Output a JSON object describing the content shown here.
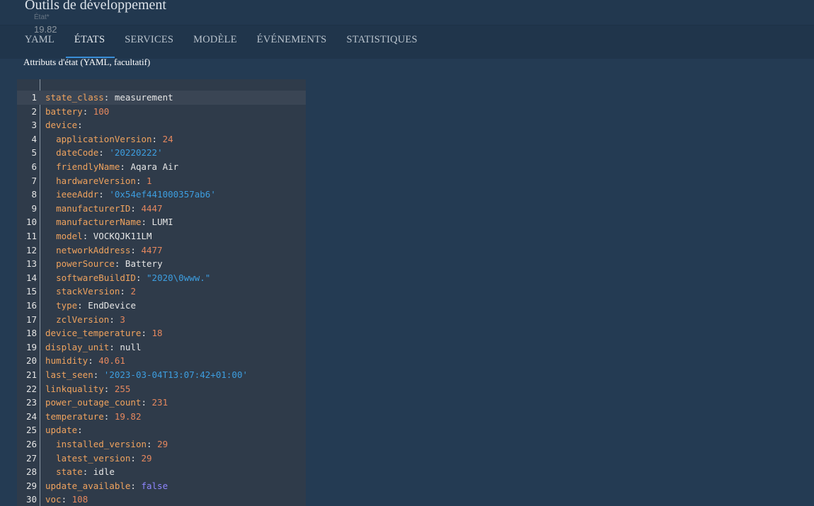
{
  "header": {
    "title": "Outils de développement"
  },
  "state_field": {
    "label": "État*",
    "value": "19.82"
  },
  "tabs": [
    {
      "label": "YAML",
      "active": false
    },
    {
      "label": "ÉTATS",
      "active": true
    },
    {
      "label": "SERVICES",
      "active": false
    },
    {
      "label": "MODÈLE",
      "active": false
    },
    {
      "label": "ÉVÉNEMENTS",
      "active": false
    },
    {
      "label": "STATISTIQUES",
      "active": false
    }
  ],
  "attributes_label": "Attributs d'état (YAML, facultatif)",
  "colors": {
    "background": "#243b53",
    "editor_bg": "#2f3b4a",
    "key": "#f0a35e",
    "number": "#e6885e",
    "string": "#3d9ee0",
    "boolean": "#8f86ff",
    "tab_indicator": "#3a8fd8"
  },
  "editor": {
    "lines": [
      {
        "num": "1",
        "indent": "",
        "key": "state_class",
        "value": "measurement",
        "type": "plain"
      },
      {
        "num": "2",
        "indent": "",
        "key": "battery",
        "value": "100",
        "type": "number"
      },
      {
        "num": "3",
        "indent": "",
        "key": "device",
        "value": "",
        "type": "plain"
      },
      {
        "num": "4",
        "indent": "  ",
        "key": "applicationVersion",
        "value": "24",
        "type": "number"
      },
      {
        "num": "5",
        "indent": "  ",
        "key": "dateCode",
        "value": "'20220222'",
        "type": "string"
      },
      {
        "num": "6",
        "indent": "  ",
        "key": "friendlyName",
        "value": "Aqara Air",
        "type": "plain"
      },
      {
        "num": "7",
        "indent": "  ",
        "key": "hardwareVersion",
        "value": "1",
        "type": "number"
      },
      {
        "num": "8",
        "indent": "  ",
        "key": "ieeeAddr",
        "value": "'0x54ef441000357ab6'",
        "type": "string"
      },
      {
        "num": "9",
        "indent": "  ",
        "key": "manufacturerID",
        "value": "4447",
        "type": "number"
      },
      {
        "num": "10",
        "indent": "  ",
        "key": "manufacturerName",
        "value": "LUMI",
        "type": "plain"
      },
      {
        "num": "11",
        "indent": "  ",
        "key": "model",
        "value": "VOCKQJK11LM",
        "type": "plain"
      },
      {
        "num": "12",
        "indent": "  ",
        "key": "networkAddress",
        "value": "4477",
        "type": "number"
      },
      {
        "num": "13",
        "indent": "  ",
        "key": "powerSource",
        "value": "Battery",
        "type": "plain"
      },
      {
        "num": "14",
        "indent": "  ",
        "key": "softwareBuildID",
        "value": "\"2020\\0www.\"",
        "type": "string"
      },
      {
        "num": "15",
        "indent": "  ",
        "key": "stackVersion",
        "value": "2",
        "type": "number"
      },
      {
        "num": "16",
        "indent": "  ",
        "key": "type",
        "value": "EndDevice",
        "type": "plain"
      },
      {
        "num": "17",
        "indent": "  ",
        "key": "zclVersion",
        "value": "3",
        "type": "number"
      },
      {
        "num": "18",
        "indent": "",
        "key": "device_temperature",
        "value": "18",
        "type": "number"
      },
      {
        "num": "19",
        "indent": "",
        "key": "display_unit",
        "value": "null",
        "type": "plain"
      },
      {
        "num": "20",
        "indent": "",
        "key": "humidity",
        "value": "40.61",
        "type": "number"
      },
      {
        "num": "21",
        "indent": "",
        "key": "last_seen",
        "value": "'2023-03-04T13:07:42+01:00'",
        "type": "string"
      },
      {
        "num": "22",
        "indent": "",
        "key": "linkquality",
        "value": "255",
        "type": "number"
      },
      {
        "num": "23",
        "indent": "",
        "key": "power_outage_count",
        "value": "231",
        "type": "number"
      },
      {
        "num": "24",
        "indent": "",
        "key": "temperature",
        "value": "19.82",
        "type": "number"
      },
      {
        "num": "25",
        "indent": "",
        "key": "update",
        "value": "",
        "type": "plain"
      },
      {
        "num": "26",
        "indent": "  ",
        "key": "installed_version",
        "value": "29",
        "type": "number"
      },
      {
        "num": "27",
        "indent": "  ",
        "key": "latest_version",
        "value": "29",
        "type": "number"
      },
      {
        "num": "28",
        "indent": "  ",
        "key": "state",
        "value": "idle",
        "type": "plain"
      },
      {
        "num": "29",
        "indent": "",
        "key": "update_available",
        "value": "false",
        "type": "boolean"
      },
      {
        "num": "30",
        "indent": "",
        "key": "voc",
        "value": "108",
        "type": "number"
      }
    ],
    "active_line": 0
  }
}
